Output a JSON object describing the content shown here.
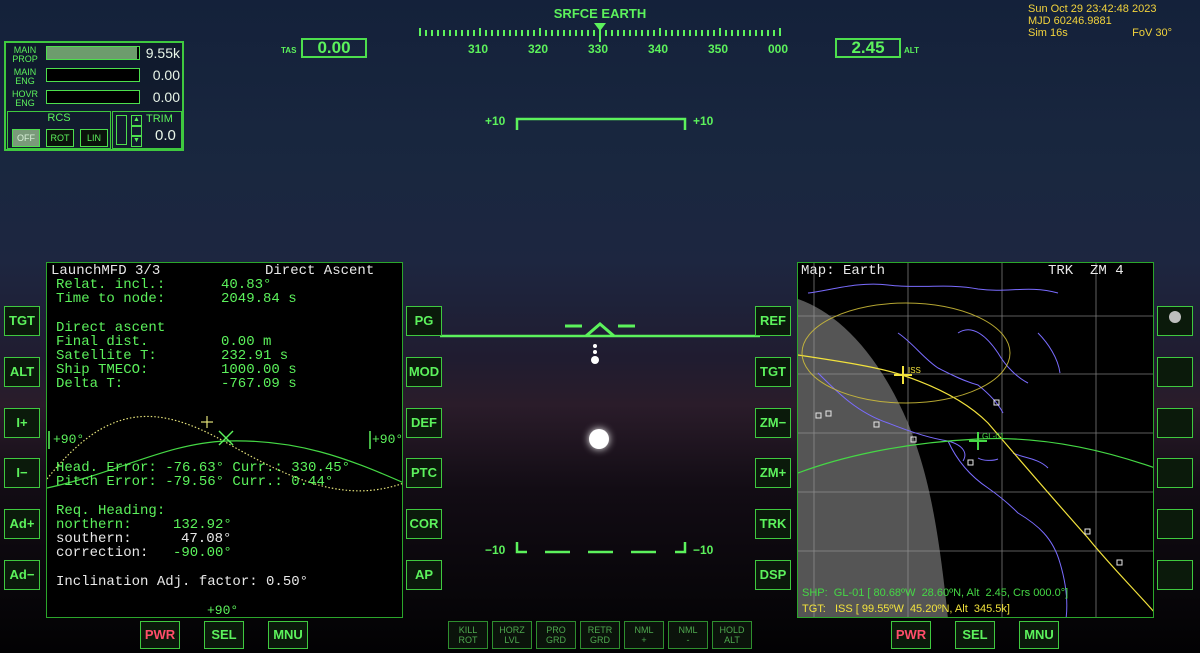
{
  "hud": {
    "mode": "SRFCE  EARTH",
    "heading_ticks": [
      "310",
      "320",
      "330",
      "340",
      "350",
      "000"
    ],
    "tas_label": "TAS",
    "tas_value": "0.00",
    "alt_label": "ALT",
    "alt_value": "2.45",
    "pitch_upper_left": "+10",
    "pitch_upper_right": "+10",
    "pitch_lower_left": "−10",
    "pitch_lower_right": "−10"
  },
  "clock": {
    "date": "Sun  Oct  29  23:42:48  2023",
    "mjd": "MJD  60246.9881",
    "sim": "Sim  16s",
    "fov": "FoV  30°"
  },
  "engines": {
    "main_prop_label": [
      "MAIN",
      "PROP"
    ],
    "main_prop_value": "9.55k",
    "main_prop_level": 0.98,
    "main_eng_label": [
      "MAIN",
      "ENG"
    ],
    "main_eng_value": "0.00",
    "main_eng_level": 0.0,
    "hovr_eng_label": [
      "HOVR",
      "ENG"
    ],
    "hovr_eng_value": "0.00",
    "hovr_eng_level": 0.0,
    "rcs_label": "RCS",
    "rcs_buttons": [
      "OFF",
      "ROT",
      "LIN"
    ],
    "trim_label": "TRIM",
    "trim_value": "0.0"
  },
  "left_mfd": {
    "header_left": "LaunchMFD 3/3",
    "header_right": "Direct Ascent",
    "lines": [
      {
        "label": "Relat. incl.:",
        "value": "40.83°"
      },
      {
        "label": "Time to node:",
        "value": "2049.84 s"
      },
      {
        "label": "Direct ascent",
        "value": ""
      },
      {
        "label": "Final dist.",
        "value": "0.00 m"
      },
      {
        "label": "Satellite T:",
        "value": "232.91 s"
      },
      {
        "label": "Ship TMECO:",
        "value": "1000.00 s"
      },
      {
        "label": "Delta T:",
        "value": "-767.09 s"
      }
    ],
    "scale_left": "+90°",
    "scale_right": "+90°",
    "scale_bottom": "+90°",
    "head_error": "Head. Error: -76.63° Curr.: 330.45°",
    "pitch_error": "Pitch Error: -79.56° Curr.: 0.44°",
    "req_heading": "Req. Heading:",
    "northern_label": "northern:",
    "northern_value": "132.92°",
    "southern_label": "southern:",
    "southern_value": "47.08°",
    "correction_label": "correction:",
    "correction_value": "-90.00°",
    "incl_adj": "Inclination Adj. factor: 0.50°",
    "left_buttons": [
      "TGT",
      "ALT",
      "I+",
      "I−",
      "Ad+",
      "Ad−"
    ],
    "right_buttons": [
      "PG",
      "MOD",
      "DEF",
      "PTC",
      "COR",
      "AP"
    ],
    "bottom_buttons": [
      "PWR",
      "SEL",
      "MNU"
    ]
  },
  "right_mfd": {
    "header_left": "Map: Earth",
    "header_right": "TRK  ZM 4",
    "iss_label": "ISS",
    "ship_label": "GL-01",
    "shp_line": "SHP:  GL-01 [ 80.68ºW  28.60ºN, Alt  2.45, Crs 000.0°]",
    "tgt_line": "TGT:   ISS [ 99.55ºW  45.20ºN, Alt  345.5k]",
    "left_buttons": [
      "REF",
      "TGT",
      "ZM−",
      "ZM+",
      "TRK",
      "DSP"
    ],
    "bottom_buttons": [
      "PWR",
      "SEL",
      "MNU"
    ]
  },
  "nav_buttons": [
    {
      "top": "KILL",
      "bottom": "ROT"
    },
    {
      "top": "HORZ",
      "bottom": "LVL"
    },
    {
      "top": "PRO",
      "bottom": "GRD"
    },
    {
      "top": "RETR",
      "bottom": "GRD"
    },
    {
      "top": "NML",
      "bottom": "+"
    },
    {
      "top": "NML",
      "bottom": "-"
    },
    {
      "top": "HOLD",
      "bottom": "ALT"
    }
  ],
  "colors": {
    "hud_green": "#5cf25c",
    "clock_yellow": "#f2d33c",
    "map_coast": "#7a6cff",
    "orbit_yellow": "#f2e23c"
  }
}
